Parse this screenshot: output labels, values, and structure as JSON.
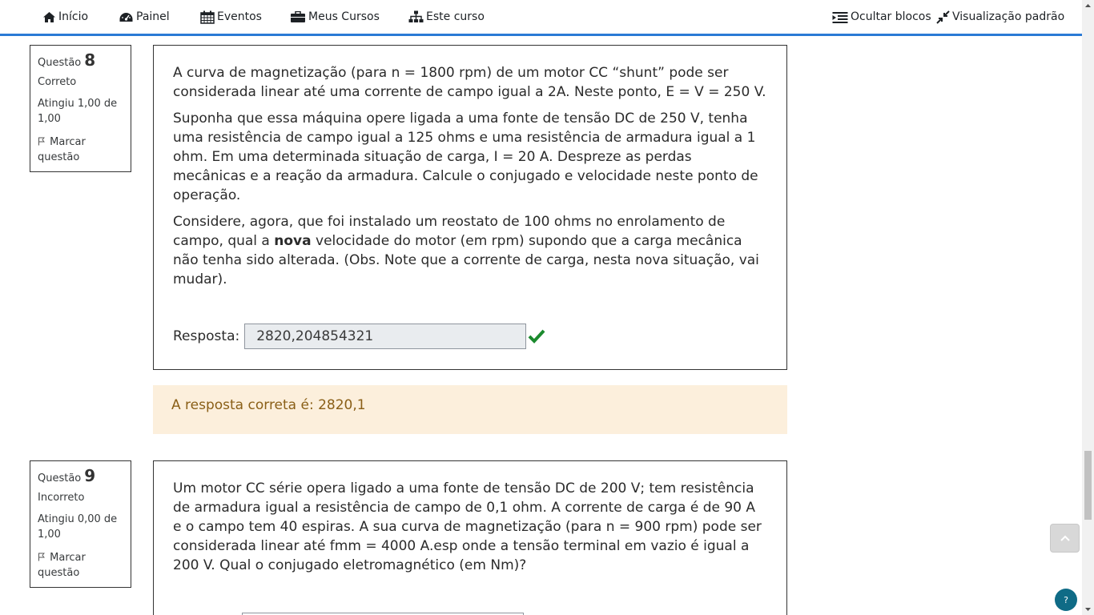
{
  "nav": {
    "inicio": "Início",
    "painel": "Painel",
    "eventos": "Eventos",
    "meus_cursos": "Meus Cursos",
    "este_curso": "Este curso",
    "ocultar_blocos": "Ocultar blocos",
    "visualizacao_padrao": "Visualização padrão"
  },
  "colors": {
    "accent": "#2a7ad5",
    "correct_check": "#1b8a2e",
    "feedback_bg": "#fcefdc",
    "feedback_text": "#8a5f17"
  },
  "q8": {
    "label": "Questão",
    "number": "8",
    "state": "Correto",
    "grade": "Atingiu 1,00 de 1,00",
    "flag": "Marcar questão",
    "p1": "A curva de magnetização (para n = 1800 rpm) de um motor CC “shunt” pode ser considerada linear até uma corrente de campo igual a 2A. Neste ponto, E = V = 250 V.",
    "p2": "Suponha que essa máquina opere ligada a uma fonte de tensão DC de 250 V, tenha uma resistência de campo igual a 125 ohms e uma resistência de armadura igual a 1 ohm. Em uma determinada situação de carga, I = 20 A. Despreze as perdas mecânicas e a reação da armadura. Calcule o conjugado e velocidade neste ponto de operação.",
    "p3_a": "Considere, agora, que foi instalado um reostato de 100 ohms no enrolamento de campo, qual a ",
    "p3_bold": "nova",
    "p3_b": " velocidade do motor (em rpm) supondo que a carga mecânica não tenha sido alterada. (Obs. Note que a corrente de carga, nesta nova situação, vai mudar).",
    "answer_label": "Resposta:",
    "answer_value": "2820,204854321",
    "feedback": "A resposta correta é: 2820,1"
  },
  "q9": {
    "label": "Questão",
    "number": "9",
    "state": "Incorreto",
    "grade": "Atingiu 0,00 de 1,00",
    "flag": "Marcar questão",
    "p1": "Um motor CC série opera ligado a uma fonte de tensão DC de 200 V; tem resistência de armadura igual a resistência de campo de 0,1 ohm. A corrente de carga é de 90 A e o campo tem 40 espiras. A sua curva de magnetização (para n = 900 rpm) pode ser considerada linear até fmm = 4000 A.esp onde a tensão terminal em vazio é igual a 200 V. Qual o conjugado eletromagnético (em Nm)?"
  },
  "help": "?"
}
